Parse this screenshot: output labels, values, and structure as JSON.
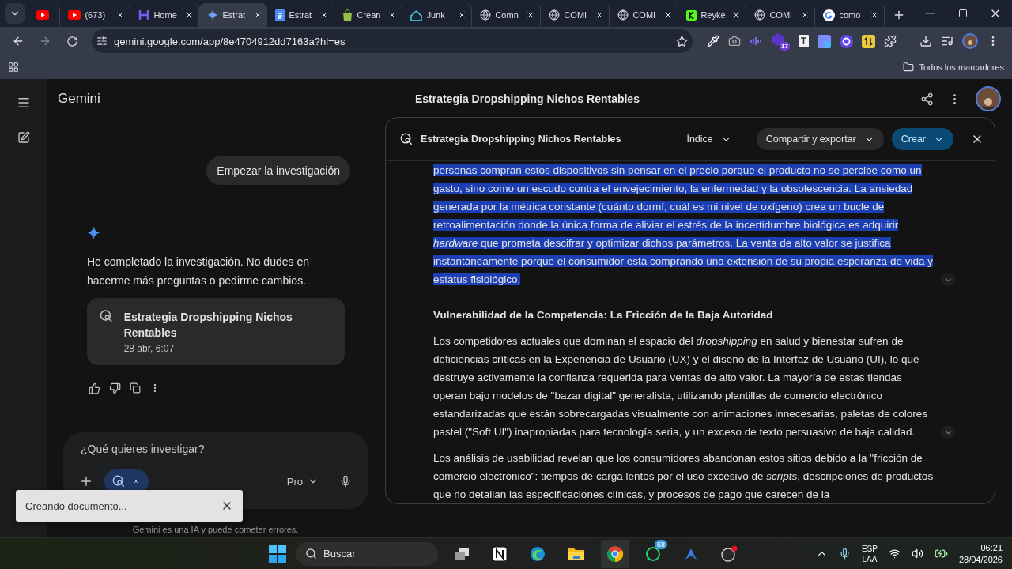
{
  "browser": {
    "tabs": [
      {
        "kind": "youtube",
        "selected": false
      },
      {
        "kind": "youtube",
        "title": "(673)",
        "selected": false
      },
      {
        "kind": "home",
        "title": "Home",
        "selected": false
      },
      {
        "kind": "spark",
        "title": "Estrat",
        "selected": true
      },
      {
        "kind": "docs",
        "title": "Estrat",
        "selected": false
      },
      {
        "kind": "bag",
        "title": "Crean",
        "selected": false
      },
      {
        "kind": "house",
        "title": "Junk",
        "selected": false
      },
      {
        "kind": "globe",
        "title": "Comn",
        "selected": false
      },
      {
        "kind": "globe",
        "title": "COMI",
        "selected": false
      },
      {
        "kind": "globe",
        "title": "COMI",
        "selected": false
      },
      {
        "kind": "kick",
        "title": "Reyke",
        "selected": false
      },
      {
        "kind": "globe",
        "title": "COMI",
        "selected": false
      },
      {
        "kind": "google",
        "title": "como",
        "selected": false
      }
    ],
    "url": "gemini.google.com/app/8e4704912dd7163a?hl=es",
    "extension_badge": "17",
    "bookmarks_folder": "Todos los marcadores"
  },
  "app": {
    "name": "Gemini",
    "conversation_title": "Estrategia Dropshipping Nichos Rentables"
  },
  "chat": {
    "user_message": "Empezar la investigación",
    "reply": "He completado la investigación. No dudes en hacerme más preguntas o pedirme cambios.",
    "report_card": {
      "title": "Estrategia Dropshipping Nichos Rentables",
      "date": "28 abr, 6:07"
    }
  },
  "composer": {
    "placeholder": "¿Qué quieres investigar?",
    "model": "Pro"
  },
  "disclaimer": "Gemini es una IA y puede cometer errores.",
  "toast": {
    "message": "Creando documento..."
  },
  "panel": {
    "title": "Estrategia Dropshipping Nichos Rentables",
    "buttons": [
      {
        "label": "Índice",
        "kind": "plain"
      },
      {
        "label": "Compartir y exportar",
        "kind": "tonal"
      },
      {
        "label": "Crear",
        "kind": "primary"
      }
    ],
    "blocks": [
      {
        "kind": "paragraph",
        "selected": true,
        "sources": true,
        "text": "personas compran estos dispositivos sin pensar en el precio porque el producto no se percibe como un gasto, sino como un escudo contra el envejecimiento, la enfermedad y la obsolescencia. La ansiedad generada por la métrica constante (cuánto dormí, cuál es mi nivel de oxígeno) crea un bucle de retroalimentación donde la única forma de aliviar el estrés de la incertidumbre biológica es adquirir *hardware* que prometa descifrar y optimizar dichos parámetros. La venta de alto valor se justifica instantáneamente porque el consumidor está comprando una extensión de su propia esperanza de vida y estatus fisiológico."
      },
      {
        "kind": "heading",
        "text": "Vulnerabilidad de la Competencia: La Fricción de la Baja Autoridad"
      },
      {
        "kind": "paragraph",
        "selected": false,
        "sources": true,
        "text": "Los competidores actuales que dominan el espacio del *dropshipping* en salud y bienestar sufren de deficiencias críticas en la Experiencia de Usuario (UX) y el diseño de la Interfaz de Usuario (UI), lo que destruye activamente la confianza requerida para ventas de alto valor. La mayoría de estas tiendas operan bajo modelos de \"bazar digital\" generalista, utilizando plantillas de comercio electrónico estandarizadas que están sobrecargadas visualmente con animaciones innecesarias, paletas de colores pastel (\"Soft UI\") inapropiadas para tecnología seria, y un exceso de texto persuasivo de baja calidad."
      },
      {
        "kind": "paragraph",
        "selected": false,
        "sources": false,
        "text": "Los análisis de usabilidad revelan que los consumidores abandonan estos sitios debido a la \"fricción de comercio electrónico\": tiempos de carga lentos por el uso excesivo de *scripts*, descripciones de productos que no detallan las especificaciones clínicas, y procesos de pago que carecen de la"
      }
    ]
  },
  "taskbar": {
    "search_placeholder": "Buscar",
    "whatsapp_badge": "68",
    "language": "ESP",
    "layout": "LAA",
    "time": "06:21",
    "date": "28/04/2026"
  }
}
